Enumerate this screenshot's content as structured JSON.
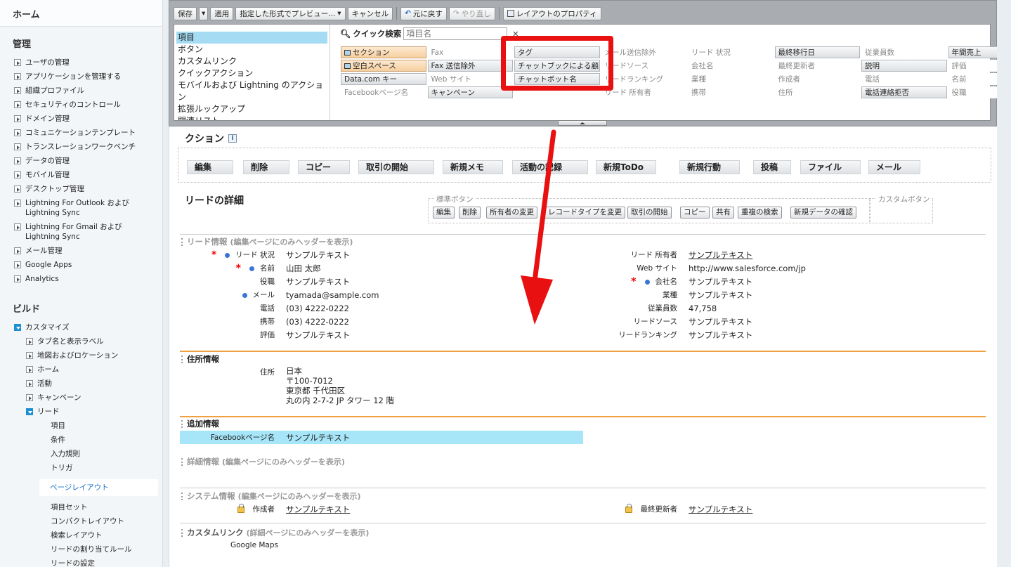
{
  "sidebar": {
    "home": "ホーム",
    "admin_title": "管理",
    "admin_items": [
      "ユーザの管理",
      "アプリケーションを管理する",
      "組織プロファイル",
      "セキュリティのコントロール",
      "ドメイン管理",
      "コミュニケーションテンプレート",
      "トランスレーションワークベンチ",
      "データの管理",
      "モバイル管理",
      "デスクトップ管理",
      "Lightning For Outlook および Lightning Sync",
      "Lightning For Gmail および Lightning Sync",
      "メール管理",
      "Google Apps",
      "Analytics"
    ],
    "build_title": "ビルド",
    "customize": "カスタマイズ",
    "customize_items": [
      "タブ名と表示ラベル",
      "地図およびロケーション",
      "ホーム",
      "活動",
      "キャンペーン"
    ],
    "lead": "リード",
    "lead_items": [
      "項目",
      "条件",
      "入力規則",
      "トリガ"
    ],
    "lead_active": "ページレイアウト",
    "lead_items_after": [
      "項目セット",
      "コンパクトレイアウト",
      "検索レイアウト",
      "リードの割り当てルール",
      "リードの設定"
    ]
  },
  "toolbar": {
    "save": "保存",
    "quick_save": "適用",
    "preview": "指定した形式でプレビュー...",
    "cancel": "キャンセル",
    "undo": "元に戻す",
    "redo": "やり直し",
    "layout_props": "レイアウトのプロパティ"
  },
  "palette": {
    "categories": [
      "項目",
      "ボタン",
      "カスタムリンク",
      "クイックアクション",
      "モバイルおよび Lightning のアクション",
      "拡張ルックアップ",
      "関連リスト"
    ],
    "quick_search_label": "クイック検索",
    "quick_search_placeholder": "項目名",
    "quick_search_clear": "✕",
    "fields": [
      [
        "セクション",
        "Fax",
        "タグ",
        "メール送信除外",
        "リード 状況",
        "最終移行日",
        "従業員数",
        "年間売上"
      ],
      [
        "空白スペース",
        "Fax 送信除外",
        "チャットブックによる顧客",
        "リードソース",
        "会社名",
        "最終更新者",
        "説明",
        "評価"
      ],
      [
        "Data.com キー",
        "Web サイト",
        "チャットボット名",
        "リードランキング",
        "業種",
        "作成者",
        "電話",
        "名前"
      ],
      [
        "Facebookページ名",
        "キャンペーン",
        "",
        "リード 所有者",
        "携帯",
        "住所",
        "電話連絡拒否",
        "役職"
      ]
    ]
  },
  "layout": {
    "actions_title": "クション",
    "actions": [
      "編集",
      "削除",
      "コピー",
      "取引の開始",
      "新規メモ",
      "活動の記録",
      "新規ToDo",
      "新規行動",
      "投稿",
      "ファイル",
      "メール"
    ],
    "detail_title": "リードの詳細",
    "standard_buttons_label": "標準ボタン",
    "standard_buttons": [
      "編集",
      "削除",
      "所有者の変更",
      "レコードタイプを変更",
      "取引の開始",
      "コピー",
      "共有",
      "重複の検索",
      "新規データの確認"
    ],
    "custom_buttons_label": "カスタムボタン",
    "lead_info": {
      "title": "リード情報",
      "hint": "(編集ページにのみヘッダーを表示)",
      "left": [
        {
          "label": "リード 状況",
          "value": "サンプルテキスト"
        },
        {
          "label": "名前",
          "value": "山田 太郎"
        },
        {
          "label": "役職",
          "value": "サンプルテキスト"
        },
        {
          "label": "メール",
          "value": "tyamada@sample.com"
        },
        {
          "label": "電話",
          "value": "(03) 4222-0222"
        },
        {
          "label": "携帯",
          "value": "(03) 4222-0222"
        },
        {
          "label": "評価",
          "value": "サンプルテキスト"
        }
      ],
      "right": [
        {
          "label": "リード 所有者",
          "value": "サンプルテキスト"
        },
        {
          "label": "Web サイト",
          "value": "http://www.salesforce.com/jp"
        },
        {
          "label": "会社名",
          "value": "サンプルテキスト"
        },
        {
          "label": "業種",
          "value": "サンプルテキスト"
        },
        {
          "label": "従業員数",
          "value": "47,758"
        },
        {
          "label": "リードソース",
          "value": "サンプルテキスト"
        },
        {
          "label": "リードランキング",
          "value": "サンプルテキスト"
        }
      ]
    },
    "address_info": {
      "title": "住所情報",
      "label": "住所",
      "lines": [
        "日本",
        "〒100-7012",
        "東京都 千代田区",
        "丸の内 2-7-2 JP タワー 12 階"
      ]
    },
    "additional_info": {
      "title": "追加情報",
      "label": "Facebookページ名",
      "value": "サンプルテキスト"
    },
    "description_info": {
      "title": "詳細情報",
      "hint": "(編集ページにのみヘッダーを表示)"
    },
    "system_info": {
      "title": "システム情報",
      "hint": "(編集ページにのみヘッダーを表示)",
      "created_label": "作成者",
      "created_value": "サンプルテキスト",
      "modified_label": "最終更新者",
      "modified_value": "サンプルテキスト"
    },
    "custom_links": {
      "title": "カスタムリンク",
      "hint": "(詳細ページにのみヘッダーを表示)",
      "link": "Google Maps"
    }
  },
  "colors": {
    "highlight_box": "#e81010",
    "arrow": "#e81010",
    "section_line_orange": "#f0a040",
    "selected_category": "#a6dcf3"
  }
}
